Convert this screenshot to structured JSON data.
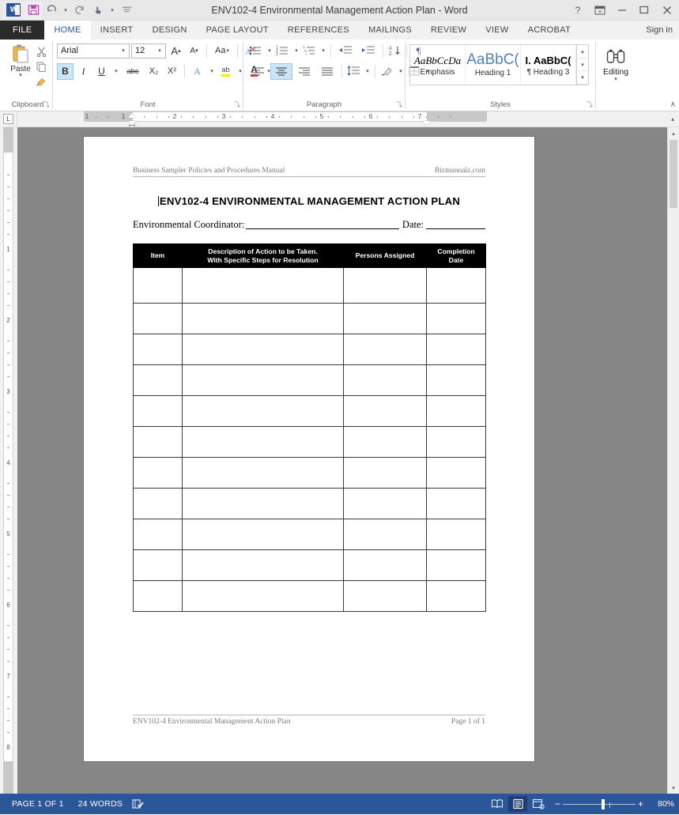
{
  "window": {
    "title": "ENV102-4 Environmental Management Action Plan - Word",
    "help_label": "?",
    "ribbon_display_label": "⎇",
    "minimize_label": "—",
    "maximize_label": "❐",
    "close_label": "✕"
  },
  "quick_access": {
    "word_logo_label": "W",
    "save_label": "💾",
    "undo_label": "↶",
    "redo_label": "↻",
    "touch_mode_label": "☝",
    "customize_label": "☷"
  },
  "tabs": [
    {
      "label": "FILE",
      "active": false
    },
    {
      "label": "HOME",
      "active": true
    },
    {
      "label": "INSERT",
      "active": false
    },
    {
      "label": "DESIGN",
      "active": false
    },
    {
      "label": "PAGE LAYOUT",
      "active": false
    },
    {
      "label": "REFERENCES",
      "active": false
    },
    {
      "label": "MAILINGS",
      "active": false
    },
    {
      "label": "REVIEW",
      "active": false
    },
    {
      "label": "VIEW",
      "active": false
    },
    {
      "label": "ACROBAT",
      "active": false
    }
  ],
  "sign_in_label": "Sign in",
  "ribbon": {
    "clipboard": {
      "group_label": "Clipboard",
      "paste_label": "Paste",
      "paste_caret": "▾",
      "cut_label": "✂",
      "copy_label": "⧉",
      "format_painter_label": "✐",
      "dialog_launcher": "⤵"
    },
    "font": {
      "group_label": "Font",
      "font_name": "Arial",
      "font_size": "12",
      "grow_font_label": "A˄",
      "shrink_font_label": "A˅",
      "change_case_label": "Aa",
      "clear_formatting_label": "A",
      "bold_label": "B",
      "italic_label": "I",
      "underline_label": "U",
      "strikethrough_label": "abc",
      "subscript_label": "X₂",
      "superscript_label": "X²",
      "text_effects_label": "A",
      "highlight_label": "ab",
      "font_color_label": "A",
      "dialog_launcher": "⤵"
    },
    "paragraph": {
      "group_label": "Paragraph",
      "bullets_label": "☰",
      "numbering_label": "☰",
      "multilevel_label": "☰",
      "decrease_indent_label": "⇤",
      "increase_indent_label": "⇥",
      "sort_label": "↕",
      "show_marks_label": "¶",
      "align_left_label": "≡",
      "align_center_label": "≡",
      "align_right_label": "≡",
      "justify_label": "≡",
      "line_spacing_label": "↕",
      "shading_label": "▣",
      "borders_label": "⊞",
      "dialog_launcher": "⤵"
    },
    "styles": {
      "group_label": "Styles",
      "items": [
        {
          "preview": "AaBbCcDa",
          "name": "Emphasis"
        },
        {
          "preview": "AaBbC(",
          "name": "Heading 1"
        },
        {
          "preview": "I. AaBbC(",
          "name": "¶ Heading 3"
        }
      ],
      "scroll_up": "▴",
      "scroll_down": "▾",
      "more": "⍂",
      "dialog_launcher": "⤵"
    },
    "editing": {
      "group_label": "Editing",
      "button_label": "Editing",
      "icon_label": "🔭",
      "caret": "▾"
    },
    "collapse_label": "∧"
  },
  "ruler": {
    "tab_selector_label": "L",
    "horizontal_numbers": [
      "1",
      "1",
      "2",
      "3",
      "4",
      "5",
      "6",
      "7"
    ],
    "vertical_numbers": [
      "1",
      "2",
      "3",
      "4",
      "5",
      "6",
      "7",
      "8"
    ],
    "scroll_up_label": "▴"
  },
  "document": {
    "header_left": "Business Sampler Policies and Procedures Manual",
    "header_right": "Bizmanualz.com",
    "title": "ENV102-4   ENVIRONMENTAL MANAGEMENT ACTION PLAN",
    "coordinator_label": "Environmental Coordinator:",
    "coordinator_value": "",
    "date_label": "Date:",
    "date_value": "",
    "footer_left": "ENV102-4 Environmental Management Action Plan",
    "footer_right": "Page 1 of 1",
    "table": {
      "headers": [
        "Item",
        "Description of Action to be Taken.\nWith Specific Steps for Resolution",
        "Persons Assigned",
        "Completion\nDate"
      ],
      "header_line1": [
        "Item",
        "Description of Action to be Taken.",
        "Persons Assigned",
        "Completion"
      ],
      "header_line2": [
        "",
        "With Specific Steps for Resolution",
        "",
        "Date"
      ],
      "row_count": 11,
      "rows": [
        [
          "",
          "",
          "",
          ""
        ],
        [
          "",
          "",
          "",
          ""
        ],
        [
          "",
          "",
          "",
          ""
        ],
        [
          "",
          "",
          "",
          ""
        ],
        [
          "",
          "",
          "",
          ""
        ],
        [
          "",
          "",
          "",
          ""
        ],
        [
          "",
          "",
          "",
          ""
        ],
        [
          "",
          "",
          "",
          ""
        ],
        [
          "",
          "",
          "",
          ""
        ],
        [
          "",
          "",
          "",
          ""
        ],
        [
          "",
          "",
          "",
          ""
        ]
      ]
    }
  },
  "scrollbar": {
    "up_arrow": "▴",
    "down_arrow": "▾"
  },
  "status_bar": {
    "page_label": "PAGE 1 OF 1",
    "words_label": "24 WORDS",
    "proofing_icon": "☑",
    "read_mode_label": "📖",
    "print_layout_label": "▤",
    "web_layout_label": "▧",
    "zoom_out_label": "−",
    "zoom_in_label": "+",
    "zoom_value": "80%"
  },
  "colors": {
    "accent": "#2b579a",
    "title_bar": "#e8e8e8",
    "ribbon_bg": "#ffffff",
    "canvas": "#868686",
    "table_header_bg": "#000000"
  }
}
